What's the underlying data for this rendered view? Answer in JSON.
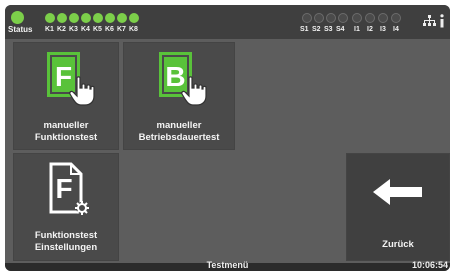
{
  "status_bar": {
    "status_label": "Status",
    "k_labels": [
      "K1",
      "K2",
      "K3",
      "K4",
      "K5",
      "K6",
      "K7",
      "K8"
    ],
    "s_labels": [
      "S1",
      "S2",
      "S3",
      "S4",
      "I1",
      "I2",
      "I3",
      "I4"
    ],
    "status_led_color": "#7ccf4a",
    "k_leds_state": "on",
    "s_leds_state": "off",
    "icons": [
      "network-icon",
      "info-icon"
    ]
  },
  "tiles": {
    "manual_function": {
      "icon_letter": "F",
      "icon_color": "#59c23a",
      "line1": "manueller",
      "line2": "Funktionstest"
    },
    "manual_duration": {
      "icon_letter": "B",
      "icon_color": "#59c23a",
      "line1": "manueller",
      "line2": "Betriebsdauertest"
    },
    "function_settings": {
      "icon_letter": "F",
      "icon_color": "#ffffff",
      "line1": "Funktionstest",
      "line2": "Einstellungen"
    },
    "back": {
      "label": "Zurück"
    }
  },
  "bottom_bar": {
    "title": "Testmenü",
    "time": "10:06:54"
  }
}
